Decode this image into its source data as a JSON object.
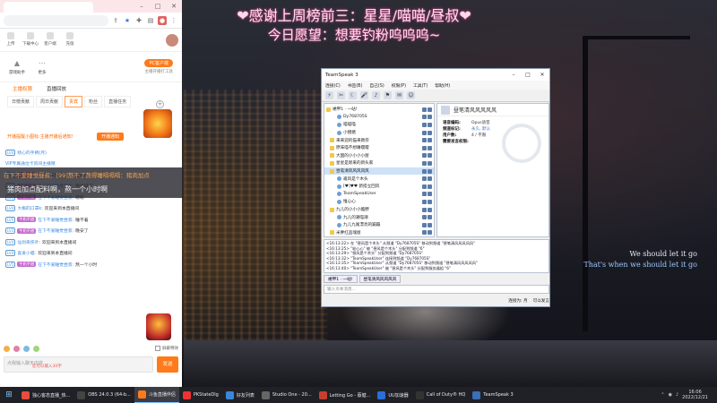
{
  "overlay": {
    "title": "❤感谢上周榜前三：星星/喵喵/昼叔❤",
    "wish": "今日愿望：想要钓粉呜呜呜~"
  },
  "lyrics": {
    "line1": "We should let it go",
    "line2": "That's when we should let it go"
  },
  "browser": {
    "shortcuts": [
      "上传",
      "下载中心",
      "客户端",
      "充值"
    ],
    "tools": [
      "游戏助手",
      "更多"
    ],
    "pc_badge": "PC客户端",
    "pc_sub": "主播开播打工具",
    "host_tabs": [
      "主播权限",
      "直播回放"
    ],
    "tab_row": [
      "日榜贡献",
      "周日贡献",
      "贵宾",
      "粉丝",
      "直播任务"
    ],
    "notice": "开播提醒小图标:主播开播后通知!",
    "notice_btn": "开播通知",
    "chat": [
      {
        "lvl": "LV4",
        "fan": "",
        "user": "绘心的手柄(月)",
        "msg": ""
      },
      {
        "lvl": "",
        "fan": "",
        "user": "VIP专属通位卡房间主播哦",
        "msg": ""
      },
      {
        "lvl": "LV5",
        "fan": "牛奶不甜",
        "user": "在下不爱睡觉昼叔:",
        "msg": "挂机中"
      },
      {
        "lvl": "LV4",
        "fan": "牛奶不甜",
        "user": "在下不爱睡觉昼叔:",
        "msg": "我出道了"
      },
      {
        "lvl": "LV3",
        "fan": "牛奶不甜",
        "user": "在下不爱睡觉昼叔:",
        "msg": "嗯嗯"
      },
      {
        "lvl": "LV4",
        "fan": "",
        "user": "大概的口罩k:",
        "msg": "欢迎来到本直播间"
      },
      {
        "lvl": "LV5",
        "fan": "牛奶不甜",
        "user": "在下不爱睡觉昼叔:",
        "msg": "睡不着"
      },
      {
        "lvl": "LV3",
        "fan": "牛奶不甜",
        "user": "在下不爱睡觉昼叔:",
        "msg": "晚安了"
      },
      {
        "lvl": "LV4",
        "fan": "",
        "user": "仙剑奇侠叶:",
        "msg": "欢迎来到本直播间"
      },
      {
        "lvl": "LV4",
        "fan": "",
        "user": "喜爱小喵:",
        "msg": "欢迎来到本直播间"
      },
      {
        "lvl": "LV5",
        "fan": "牛奶不甜",
        "user": "在下不爱睡觉昼叔:",
        "msg": "熬一个小时"
      }
    ],
    "shield_label": "屏蔽特效",
    "input_placeholder": "点我输入聊天内容",
    "send_label": "发送",
    "send_hint": "还可以输入30字"
  },
  "float_msg": {
    "top": "在下不爱睡觉昼叔：[99]熬不了熬得睡嗝嗝嗝：猪肉加点",
    "bottom": "猪肉加点配料啊，熬一个小时啊"
  },
  "teamspeak": {
    "title": "TeamSpeak 3",
    "menu": [
      "连接(C)",
      "书签(B)",
      "自己(S)",
      "权限(P)",
      "工具(T)",
      "帮助(H)"
    ],
    "tree": [
      {
        "name": "裙甲1 · 一站!",
        "type": "server",
        "sel": false
      },
      {
        "name": "Dy768705S",
        "type": "user",
        "sel": false
      },
      {
        "name": "喵喵喵",
        "type": "user",
        "sel": false
      },
      {
        "name": "小猪猪",
        "type": "user",
        "sel": false
      },
      {
        "name": "来来迎的猫来教宗",
        "type": "channel",
        "sel": false
      },
      {
        "name": "原味喵不想睡嘤嘤",
        "type": "channel",
        "sel": false
      },
      {
        "name": "大国的小小小小屋",
        "type": "channel",
        "sel": false
      },
      {
        "name": "星星是新来的新头家",
        "type": "channel",
        "sel": false
      },
      {
        "name": "昼笔清风风风风风",
        "type": "channel",
        "sel": true
      },
      {
        "name": "邀风是个木头",
        "type": "user",
        "sel": false
      },
      {
        "name": "[♥]♥♥ 新搭立回风",
        "type": "user",
        "sel": false
      },
      {
        "name": "TeamSpeakUser",
        "type": "user",
        "sel": false
      },
      {
        "name": "惟心心",
        "type": "user",
        "sel": false
      },
      {
        "name": "九儿的小小小酷野",
        "type": "channel",
        "sel": false
      },
      {
        "name": "九儿的潮喵潮",
        "type": "user",
        "sel": false
      },
      {
        "name": "九儿九尾漂亮的蹦蹦",
        "type": "user",
        "sel": false
      },
      {
        "name": "米胖红品魂屋",
        "type": "channel",
        "sel": false
      }
    ],
    "info": {
      "name": "昼笔清风风风风风",
      "rows": [
        {
          "k": "语音编码:",
          "v": "Opus语音"
        },
        {
          "k": "频道标记:",
          "v": "永久, 默认"
        },
        {
          "k": "用户数:",
          "v": "4 / 不限"
        },
        {
          "k": "需要发言权限:",
          "v": ""
        }
      ]
    },
    "log": [
      "<16:13:22> 在 \"昼风是个木头\" 从频道 \"Dy768705S\" 移动到频道 \"昼笔清风风风风风\"",
      "<16:13:25> \"轮心心\" 被 \"昼风是个木头\" 分配到频道 \"6\"",
      "<16:13:29> \"昼风是个木头\" 分配到频道 \"Dy768705S\"",
      "<16:13:32> \"TeamSpeakUser\" 连接到频道 \"Dy768705S\"",
      "<16:13:35> \"TeamSpeakUser\" 从频道 \"Dy768705S\" 移动到频道 \"昼笔清风风风风风\"",
      "<16:13:40> \"TeamSpeakUser\" 被 \"昼风是个木头\" 分配到服务器组 \"6\""
    ],
    "chat_tabs": [
      "裙甲1 · 一站!",
      "昼笔清风风风风风"
    ],
    "input_placeholder": "输入文本消息...",
    "status_left": "",
    "status_right": [
      "连接为: 月",
      "可以发言"
    ]
  },
  "taskbar": {
    "tasks": [
      {
        "label": "独心客态直播_热...",
        "color": "#e74c3c",
        "active": false
      },
      {
        "label": "OBS 24.0.3 (64-b...",
        "color": "#444",
        "active": false
      },
      {
        "label": "斗鱼直播伴侣",
        "color": "#ff7a1a",
        "active": true
      },
      {
        "label": "PKStateDlg",
        "color": "#e33",
        "active": false
      },
      {
        "label": "好友列表",
        "color": "#3a87d8",
        "active": false
      },
      {
        "label": "Studio One - 20...",
        "color": "#666",
        "active": false
      },
      {
        "label": "Letting Go - 蔡健...",
        "color": "#c7402c",
        "active": false
      },
      {
        "label": "UU加速器",
        "color": "#2a6fd8",
        "active": false
      },
      {
        "label": "Call of Duty® HQ",
        "color": "#333",
        "active": false
      },
      {
        "label": "TeamSpeak 3",
        "color": "#3b6fb6",
        "active": false
      }
    ],
    "time": "16:06",
    "date": "2022/12/21"
  }
}
